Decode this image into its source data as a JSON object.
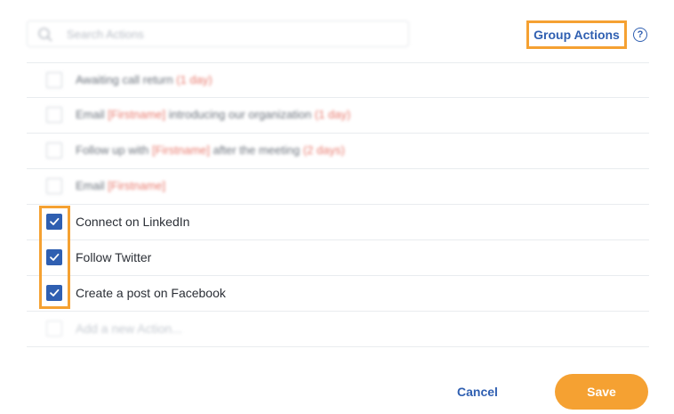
{
  "search": {
    "placeholder": "Search Actions"
  },
  "header": {
    "group_actions_label": "Group Actions",
    "help_glyph": "?"
  },
  "actions": [
    {
      "text": "Awaiting call return",
      "tag": "(1 day)",
      "checked": false,
      "blurred": true
    },
    {
      "text": "Email",
      "tag": "[Firstname]",
      "suffix": "introducing our organization",
      "tag2": "(1 day)",
      "checked": false,
      "blurred": true
    },
    {
      "text": "Follow up with",
      "tag": "[Firstname]",
      "suffix": "after the meeting",
      "tag2": "(2 days)",
      "checked": false,
      "blurred": true
    },
    {
      "text": "Email",
      "tag": "[Firstname]",
      "checked": false,
      "blurred": true
    },
    {
      "text": "Connect on LinkedIn",
      "checked": true,
      "blurred": false
    },
    {
      "text": "Follow Twitter",
      "checked": true,
      "blurred": false
    },
    {
      "text": "Create a post on Facebook",
      "checked": true,
      "blurred": false
    }
  ],
  "add_action": {
    "placeholder": "Add a new Action..."
  },
  "footer": {
    "cancel_label": "Cancel",
    "save_label": "Save"
  },
  "colors": {
    "accent": "#f5a132",
    "link": "#2f5fb1",
    "checkbox": "#2f5fb1",
    "tag": "#e8796d"
  }
}
